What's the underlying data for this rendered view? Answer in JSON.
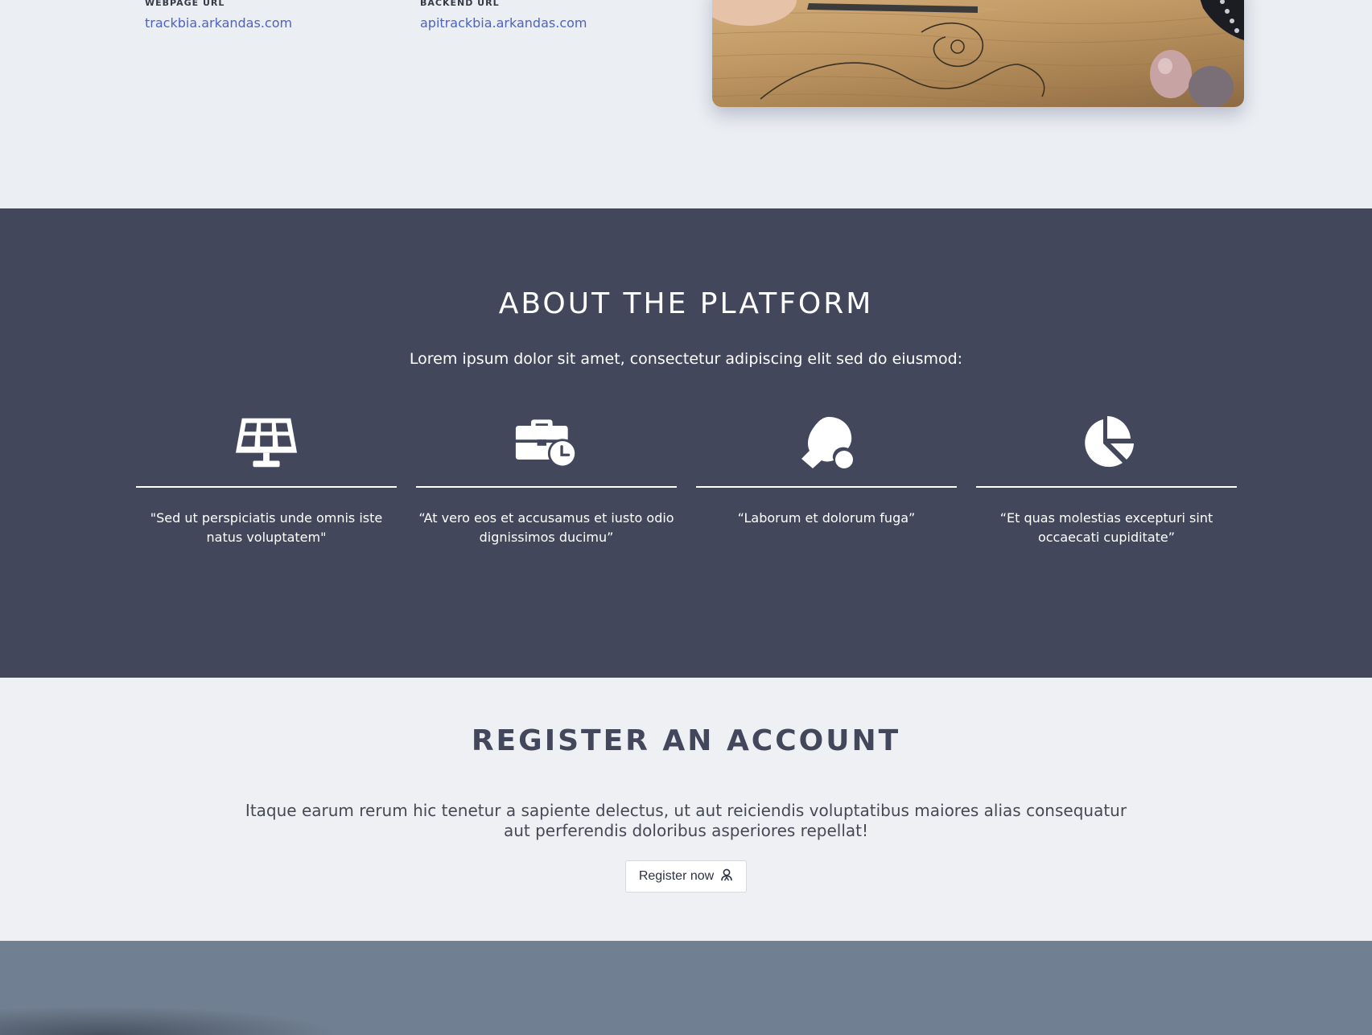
{
  "urls": {
    "webpage": {
      "label": "WEBPAGE URL",
      "link": "trackbia.arkandas.com"
    },
    "backend": {
      "label": "BACKEND URL",
      "link": "apitrackbia.arkandas.com"
    }
  },
  "about": {
    "title": "ABOUT THE PLATFORM",
    "subtitle": "Lorem ipsum dolor sit amet, consectetur adipiscing elit sed do eiusmod:",
    "features": [
      {
        "icon": "solar-panel-icon",
        "quote": "\"Sed ut perspiciatis unde omnis iste natus voluptatem\""
      },
      {
        "icon": "business-time-icon",
        "quote": "“At vero eos et accusamus et iusto odio dignissimos ducimu”"
      },
      {
        "icon": "table-tennis-icon",
        "quote": "“Laborum et dolorum fuga”"
      },
      {
        "icon": "chart-pie-icon",
        "quote": "“Et quas molestias excepturi sint occaecati cupiditate”"
      }
    ]
  },
  "register": {
    "title": "REGISTER AN ACCOUNT",
    "text": "Itaque earum rerum hic tenetur a sapiente delectus, ut aut reiciendis voluptatibus maiores alias consequatur aut perferendis doloribus asperiores repellat!",
    "button_label": "Register now",
    "button_icon": "user-badge-icon"
  },
  "colors": {
    "about_background": "#43475c",
    "link": "#4c63c7",
    "footer_background": "#707f91"
  }
}
